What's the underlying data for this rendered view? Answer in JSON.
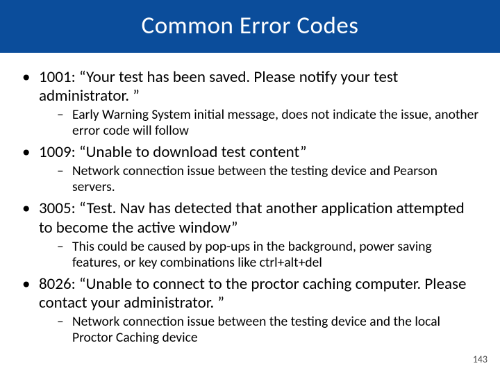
{
  "title": "Common Error Codes",
  "items": [
    {
      "main": "1001: “Your test has been saved. Please notify your test administrator. ”",
      "sub": "Early Warning System initial message, does not indicate the issue, another error code will follow"
    },
    {
      "main": "1009: “Unable to download test content”",
      "sub": "Network connection issue between the testing device and Pearson servers."
    },
    {
      "main": "3005: “Test. Nav has detected that another application attempted to become the active window”",
      "sub": "This could be caused by pop-ups in the background, power saving features, or key combinations like ctrl+alt+del"
    },
    {
      "main": "8026: “Unable to connect to the proctor caching computer. Please contact your administrator. ”",
      "sub": "Network connection issue between the testing device and the local Proctor Caching device"
    }
  ],
  "page_number": "143"
}
